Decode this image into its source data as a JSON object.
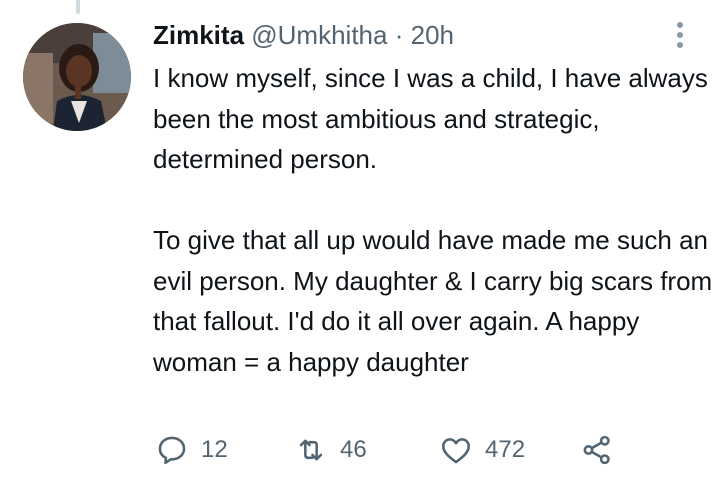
{
  "tweet": {
    "display_name": "Zimkita",
    "handle": "@Umkhitha",
    "separator": "·",
    "time": "20h",
    "paragraphs": [
      "I know myself, since I was a child, I have always been the most ambitious and strategic, determined person.",
      "To give that all up would have made me such an evil person. My daughter & I carry big scars from that fallout. I'd do it all over again. A happy woman = a happy daughter"
    ],
    "avatar_icon": "profile-photo"
  },
  "actions": {
    "reply": {
      "icon": "reply-icon",
      "count": "12"
    },
    "retweet": {
      "icon": "retweet-icon",
      "count": "46"
    },
    "like": {
      "icon": "heart-icon",
      "count": "472"
    },
    "share": {
      "icon": "share-icon"
    }
  },
  "colors": {
    "text": "#0f1419",
    "secondary": "#536471",
    "thread_line": "#cfd9de"
  }
}
